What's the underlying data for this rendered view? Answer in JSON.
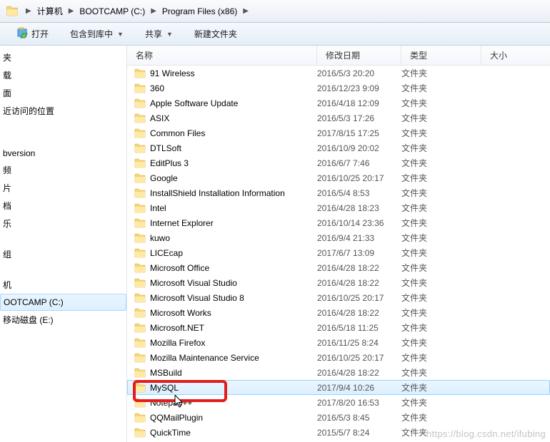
{
  "breadcrumb": {
    "items": [
      "计算机",
      "BOOTCAMP (C:)",
      "Program Files (x86)"
    ]
  },
  "toolbar": {
    "open": "打开",
    "include": "包含到库中",
    "share": "共享",
    "newfolder": "新建文件夹"
  },
  "sidebar": {
    "items": [
      {
        "label": "夹",
        "indent": 0
      },
      {
        "label": "载",
        "indent": 0
      },
      {
        "label": "面",
        "indent": 0
      },
      {
        "label": "近访问的位置",
        "indent": 0
      },
      {
        "label": "",
        "blank": true
      },
      {
        "label": "",
        "blank": true
      },
      {
        "label": "bversion",
        "indent": 0
      },
      {
        "label": "频",
        "indent": 0
      },
      {
        "label": "片",
        "indent": 0
      },
      {
        "label": "档",
        "indent": 0
      },
      {
        "label": "乐",
        "indent": 0
      },
      {
        "label": "",
        "blank": true
      },
      {
        "label": "组",
        "indent": 0
      },
      {
        "label": "",
        "blank": true
      },
      {
        "label": "机",
        "indent": 0
      },
      {
        "label": "OOTCAMP (C:)",
        "indent": 0,
        "selected": true
      },
      {
        "label": "移动磁盘 (E:)",
        "indent": 0
      }
    ]
  },
  "columns": {
    "name": "名称",
    "date": "修改日期",
    "type": "类型",
    "size": "大小"
  },
  "items": [
    {
      "name": "91 Wireless",
      "date": "2016/5/3 20:20",
      "type": "文件夹"
    },
    {
      "name": "360",
      "date": "2016/12/23 9:09",
      "type": "文件夹"
    },
    {
      "name": "Apple Software Update",
      "date": "2016/4/18 12:09",
      "type": "文件夹"
    },
    {
      "name": "ASIX",
      "date": "2016/5/3 17:26",
      "type": "文件夹"
    },
    {
      "name": "Common Files",
      "date": "2017/8/15 17:25",
      "type": "文件夹"
    },
    {
      "name": "DTLSoft",
      "date": "2016/10/9 20:02",
      "type": "文件夹"
    },
    {
      "name": "EditPlus 3",
      "date": "2016/6/7 7:46",
      "type": "文件夹"
    },
    {
      "name": "Google",
      "date": "2016/10/25 20:17",
      "type": "文件夹"
    },
    {
      "name": "InstallShield Installation Information",
      "date": "2016/5/4 8:53",
      "type": "文件夹"
    },
    {
      "name": "Intel",
      "date": "2016/4/28 18:23",
      "type": "文件夹"
    },
    {
      "name": "Internet Explorer",
      "date": "2016/10/14 23:36",
      "type": "文件夹"
    },
    {
      "name": "kuwo",
      "date": "2016/9/4 21:33",
      "type": "文件夹"
    },
    {
      "name": "LICEcap",
      "date": "2017/6/7 13:09",
      "type": "文件夹"
    },
    {
      "name": "Microsoft Office",
      "date": "2016/4/28 18:22",
      "type": "文件夹"
    },
    {
      "name": "Microsoft Visual Studio",
      "date": "2016/4/28 18:22",
      "type": "文件夹"
    },
    {
      "name": "Microsoft Visual Studio 8",
      "date": "2016/10/25 20:17",
      "type": "文件夹"
    },
    {
      "name": "Microsoft Works",
      "date": "2016/4/28 18:22",
      "type": "文件夹"
    },
    {
      "name": "Microsoft.NET",
      "date": "2016/5/18 11:25",
      "type": "文件夹"
    },
    {
      "name": "Mozilla Firefox",
      "date": "2016/11/25 8:24",
      "type": "文件夹"
    },
    {
      "name": "Mozilla Maintenance Service",
      "date": "2016/10/25 20:17",
      "type": "文件夹"
    },
    {
      "name": "MSBuild",
      "date": "2016/4/28 18:22",
      "type": "文件夹"
    },
    {
      "name": "MySQL",
      "date": "2017/9/4 10:26",
      "type": "文件夹",
      "selected": true
    },
    {
      "name": "Notepad++",
      "date": "2017/8/20 16:53",
      "type": "文件夹"
    },
    {
      "name": "QQMailPlugin",
      "date": "2016/5/3 8:45",
      "type": "文件夹"
    },
    {
      "name": "QuickTime",
      "date": "2015/5/7 8:24",
      "type": "文件夹"
    }
  ],
  "watermark": "https://blog.csdn.net/ifubing"
}
